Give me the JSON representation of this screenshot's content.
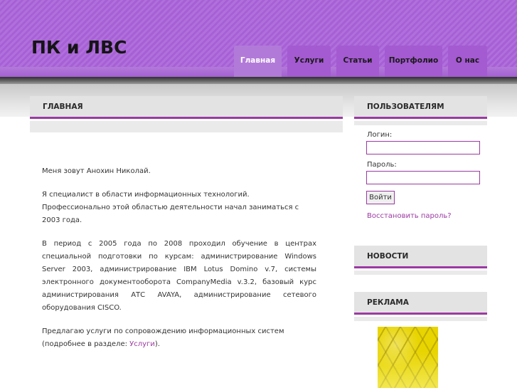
{
  "site": {
    "title": "ПК и ЛВС"
  },
  "nav": [
    {
      "label": "Главная",
      "active": true
    },
    {
      "label": "Услуги",
      "active": false
    },
    {
      "label": "Статьи",
      "active": false
    },
    {
      "label": "Портфолио",
      "active": false
    },
    {
      "label": "О нас",
      "active": false
    }
  ],
  "main": {
    "heading": "ГЛАВНАЯ",
    "p1": "Меня зовут Анохин Николай.",
    "p2": "Я специалист в области информационных технологий. Профессионально этой областью деятельности начал заниматься с 2003 года.",
    "p3": "В период с 2005 года по 2008 проходил обучение в центрах специальной подготовки по курсам: администрирование Windows Server 2003, администрирование IBM Lotus Domino v.7, системы электронного документооборота CompanyMedia v.3.2, базовый курс администрирования АТС AVAYA, администрирование сетевого оборудования CISCO.",
    "p4_text": "Предлагаю услуги по сопровождению информационных систем (подробнее в разделе: ",
    "p4_link": "Услуги",
    "p4_end": ")."
  },
  "sidebar": {
    "users_heading": "ПОЛЬЗОВАТЕЛЯМ",
    "login_label": "Логин:",
    "password_label": "Пароль:",
    "login_button": "Войти",
    "restore_link": "Восстановить пароль?",
    "news_heading": "НОВОСТИ",
    "ads_heading": "РЕКЛАМА"
  },
  "colors": {
    "header_purple": "#b070dc",
    "accent": "#9b3aa2",
    "active_tab": "#b27ad8"
  }
}
